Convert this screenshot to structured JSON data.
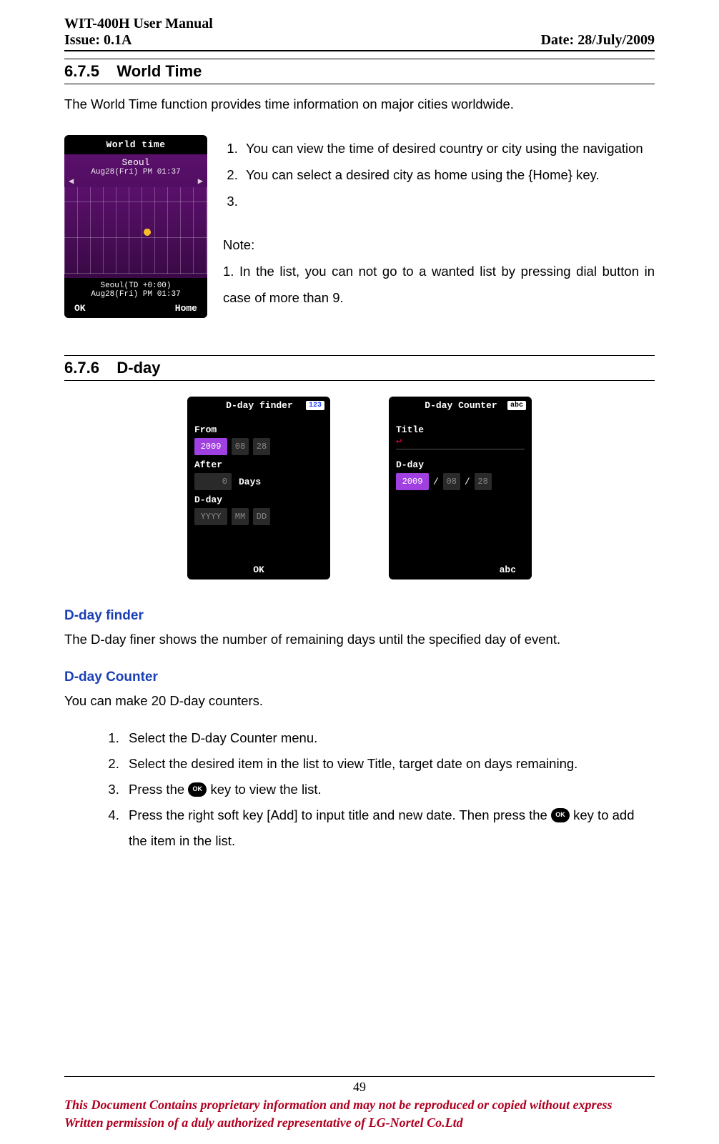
{
  "header": {
    "left_top": "WIT-400H User Manual",
    "left_bottom": "Issue: 0.1A",
    "right": "Date: 28/July/2009"
  },
  "sec1": {
    "num": "6.7.5",
    "title": "World Time",
    "intro": "The World Time function provides time information on major cities worldwide.",
    "ol": {
      "i1": "You can view the time of desired country or city using the navigation",
      "i2": "You can select a desired city as home using the {Home} key.",
      "i3": ""
    },
    "note_label": "Note:",
    "note_body": "1. In the list, you can not go to a wanted list by pressing dial button in case of more than 9."
  },
  "phone_wt": {
    "title": "World time",
    "city": "Seoul",
    "date_top": "Aug28(Fri) PM 01:37",
    "tz": "Seoul(TD +0:00)",
    "date_bottom": "Aug28(Fri) PM 01:37",
    "soft_left": "OK",
    "soft_right": "Home"
  },
  "sec2": {
    "num": "6.7.6",
    "title": "D-day"
  },
  "phone_finder": {
    "title": "D-day finder",
    "mode": "123",
    "from_label": "From",
    "from_y": "2009",
    "from_m": "08",
    "from_d": "28",
    "after_label": "After",
    "after_days_val": "0",
    "after_days_unit": "Days",
    "dday_label": "D-day",
    "dd_y": "YYYY",
    "dd_m": "MM",
    "dd_d": "DD",
    "soft_center": "OK"
  },
  "phone_counter": {
    "title": "D-day Counter",
    "mode": "abc",
    "title_label": "Title",
    "enter_glyph": "↵",
    "dday_label": "D-day",
    "y": "2009",
    "m": "08",
    "d": "28",
    "slash": "/",
    "soft_right": "abc"
  },
  "finder_section": {
    "heading": "D-day finder",
    "body": "The D-day finer shows the number of remaining days until the specified day of event."
  },
  "counter_section": {
    "heading": "D-day Counter",
    "intro": "You can make 20 D-day counters.",
    "i1": "Select the D-day Counter menu.",
    "i2": "Select the desired item in the list to view Title, target date on days remaining.",
    "i3_a": "Press the ",
    "i3_b": " key to view the list.",
    "i4_a": "Press the right soft key [Add] to input title and new date. Then press the ",
    "i4_b": " key to add the item in the list.",
    "ok": "OK"
  },
  "footer": {
    "page": "49",
    "line1": "This Document Contains proprietary information and may not be reproduced or copied without express",
    "line2": "Written permission of a duly authorized representative of LG-Nortel Co.Ltd"
  }
}
